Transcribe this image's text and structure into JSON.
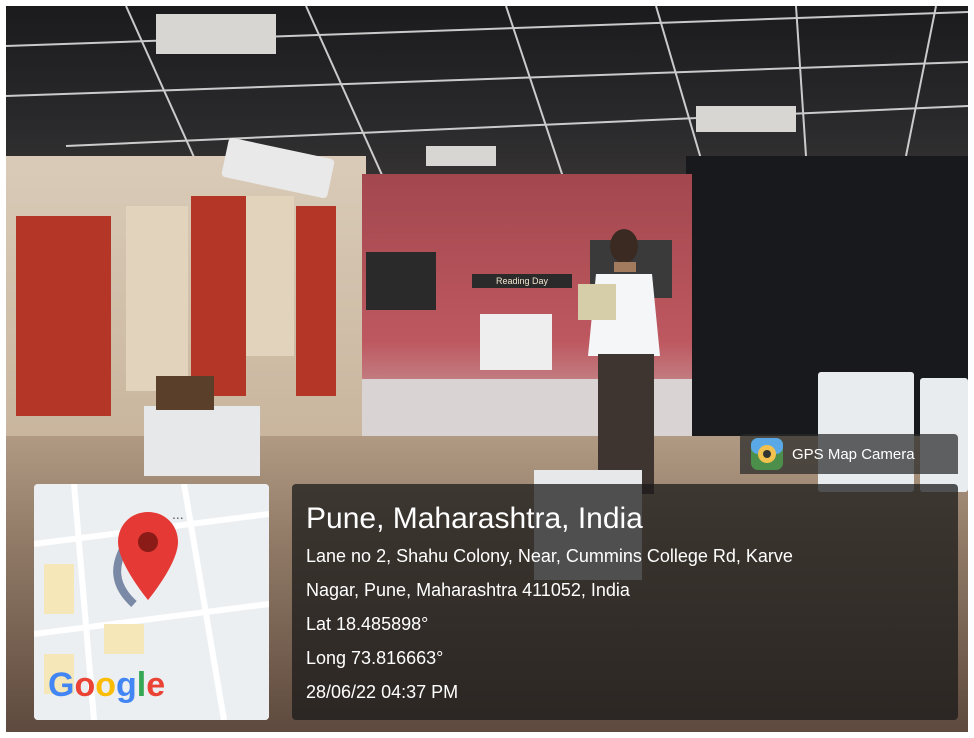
{
  "overlay": {
    "app_name": "GPS Map Camera",
    "location_title": "Pune, Maharashtra, India",
    "address_line_1": "Lane no 2, Shahu Colony, Near, Cummins College Rd, Karve",
    "address_line_2": "Nagar, Pune, Maharashtra 411052, India",
    "latitude": "Lat 18.485898°",
    "longitude": "Long 73.816663°",
    "datetime": "28/06/22 04:37 PM",
    "map_brand": "Google",
    "map_dots": "...",
    "pin_color": "#e53935"
  },
  "projection": {
    "heading": "Reading Day"
  }
}
